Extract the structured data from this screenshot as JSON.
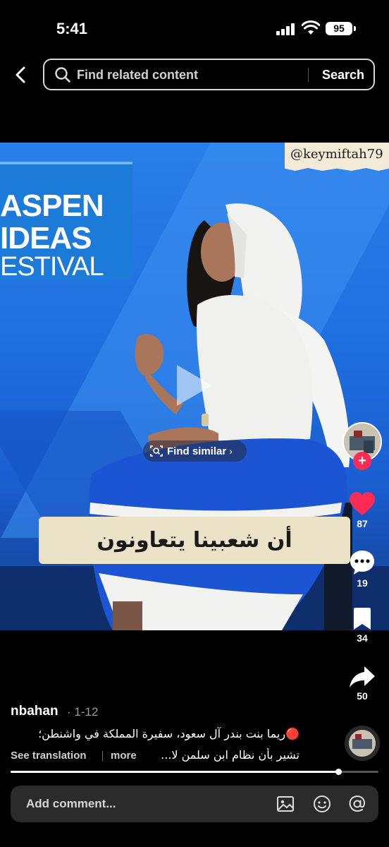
{
  "status_bar": {
    "time": "5:41",
    "battery": "95"
  },
  "search": {
    "placeholder": "Find related content",
    "button_label": "Search"
  },
  "video": {
    "event_sign": {
      "line1": "ASPEN",
      "line2": "IDEAS",
      "line3": "ESTIVAL"
    },
    "watermark": "@keymiftah79",
    "find_similar_label": "Find similar",
    "caption": "أن شعبينا يتعاونون"
  },
  "actions": {
    "likes": "87",
    "comments": "19",
    "bookmarks": "34",
    "shares": "50"
  },
  "post": {
    "username": "nbahan",
    "date": "· 1-12",
    "description_line1": "🔴ريما بنت بندر آل سعود، سفيرة المملكة في واشنطن؛",
    "description_line2": "تشير بأن نظام ابن سلمن لا...",
    "see_translation": "See translation",
    "more": "more",
    "progress": 0.89
  },
  "comment_bar": {
    "placeholder": "Add comment..."
  },
  "colors": {
    "like": "#fe2c55",
    "follow": "#fe2c55",
    "caption_bg": "#ece2c8"
  }
}
